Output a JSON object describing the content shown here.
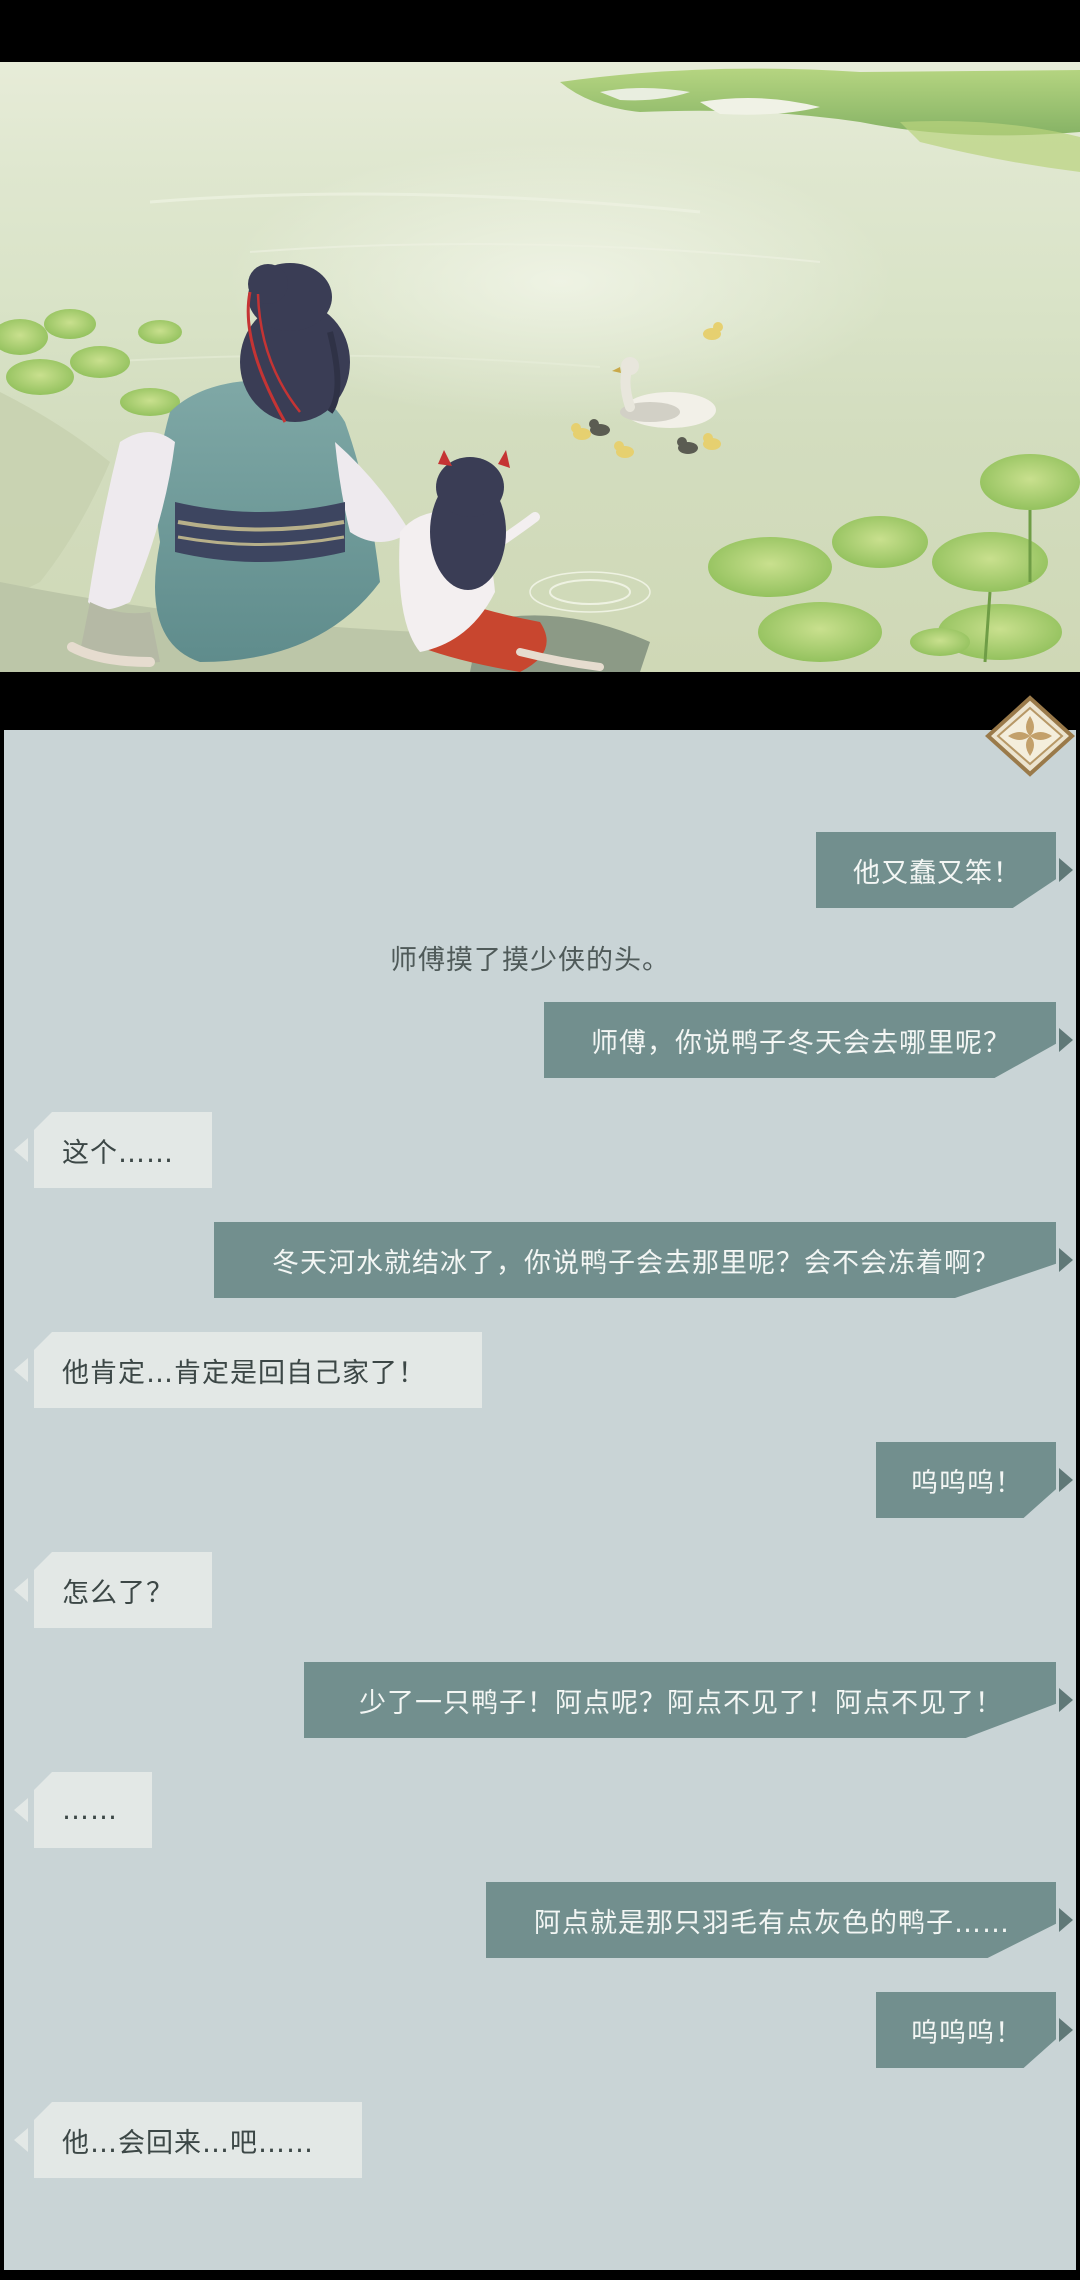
{
  "scene": {
    "image_alt": "scene-illustration",
    "colors": {
      "water": "#d9e3c7",
      "master_robe": "#6f9a9a",
      "master_sash": "#3d4560",
      "child_skirt": "#c8462f",
      "lotus_leaf": "#8fbf5a"
    }
  },
  "ui": {
    "close_icon": "ornate-diamond-close-icon"
  },
  "dialogue": [
    {
      "speaker": "player",
      "text": "他又蠢又笨！"
    },
    {
      "speaker": "narration",
      "text": "师傅摸了摸少侠的头。"
    },
    {
      "speaker": "player",
      "text": "师傅，你说鸭子冬天会去哪里呢？"
    },
    {
      "speaker": "master",
      "text": "这个……"
    },
    {
      "speaker": "player",
      "text": "冬天河水就结冰了，你说鸭子会去那里呢？会不会冻着啊？"
    },
    {
      "speaker": "master",
      "text": "他肯定…肯定是回自己家了！"
    },
    {
      "speaker": "player",
      "text": "呜呜呜！"
    },
    {
      "speaker": "master",
      "text": "怎么了？"
    },
    {
      "speaker": "player",
      "text": "少了一只鸭子！阿点呢？阿点不见了！阿点不见了！"
    },
    {
      "speaker": "master",
      "text": "……"
    },
    {
      "speaker": "player",
      "text": "阿点就是那只羽毛有点灰色的鸭子……"
    },
    {
      "speaker": "player",
      "text": "呜呜呜！"
    },
    {
      "speaker": "master",
      "text": "他…会回来…吧……"
    }
  ]
}
